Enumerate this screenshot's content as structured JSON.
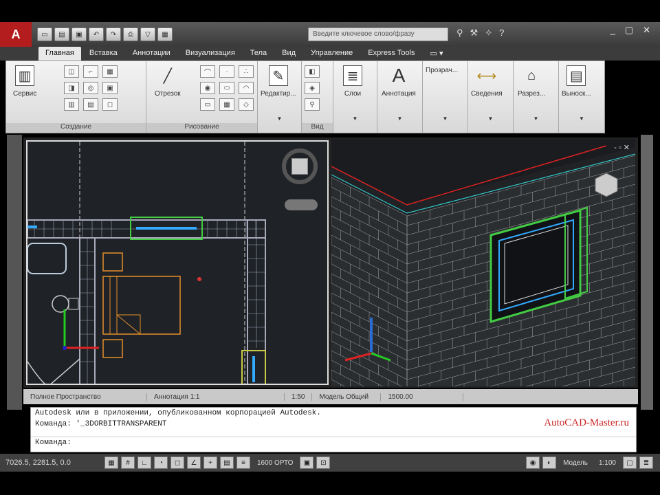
{
  "title": {
    "app_logo": "A",
    "qat_icons": [
      "new-icon",
      "open-icon",
      "save-icon",
      "undo-icon",
      "redo-icon",
      "print-icon",
      "plot-icon",
      "workspace-icon"
    ],
    "search_text": "Введите ключевое слово/фразу",
    "window_controls": [
      "_",
      "▢",
      "✕"
    ]
  },
  "tabs": [
    "Главная",
    "Вставка",
    "Аннотации",
    "Визуализация",
    "Тела",
    "Вид",
    "Управление",
    "Express Tools",
    "▭ ▾"
  ],
  "ribbon": {
    "service": "Сервис",
    "cut_tool": "Отрезок",
    "edit_tool": "Редактир...",
    "layer_tool": "Слои",
    "annotation_tool": "Аннотация",
    "transparency": "Прозрач...",
    "info_tool": "Сведения",
    "section_tool": "Разрез...",
    "output_tool": "Выноск...",
    "panel_create": "Создание",
    "panel_draw": "Рисование",
    "panel_view": "Вид"
  },
  "status": {
    "model_label": "Полное Пространство",
    "layout_label": "Аннотация 1:1",
    "scale": "1:50",
    "view_label": "Модель Общий",
    "coord_val": "1500.00"
  },
  "command": {
    "line1": "Autodesk или в приложении, опубликованном корпорацией Autodesk.",
    "line2": "Команда:  '_3DORBITTRANSPARENT",
    "line3": "Команда:",
    "watermark": "AutoCAD-Master.ru"
  },
  "bottom": {
    "coords": "7026.5, 2281.5, 0.0",
    "ortho": "1600 ОРТО",
    "space": "Модель",
    "zoom": "1:100"
  }
}
